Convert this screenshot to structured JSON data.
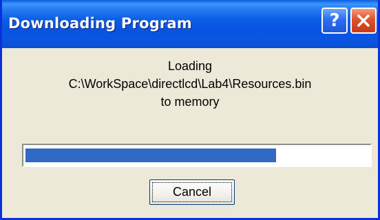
{
  "window": {
    "title": "Downloading Program"
  },
  "titlebar": {
    "help_label": "?",
    "help_icon": "help-icon",
    "close_icon": "close-icon"
  },
  "message": {
    "line1": "Loading",
    "line2": "C:\\WorkSpace\\directlcd\\Lab4\\Resources.bin",
    "line3": "to memory"
  },
  "progress": {
    "fraction": 0.73
  },
  "buttons": {
    "cancel_label": "Cancel"
  },
  "colors": {
    "titlebar": "#0a5fe6",
    "progress_fill": "#316ac5",
    "close_button": "#e0512d",
    "dialog_background": "#ece9d8"
  }
}
